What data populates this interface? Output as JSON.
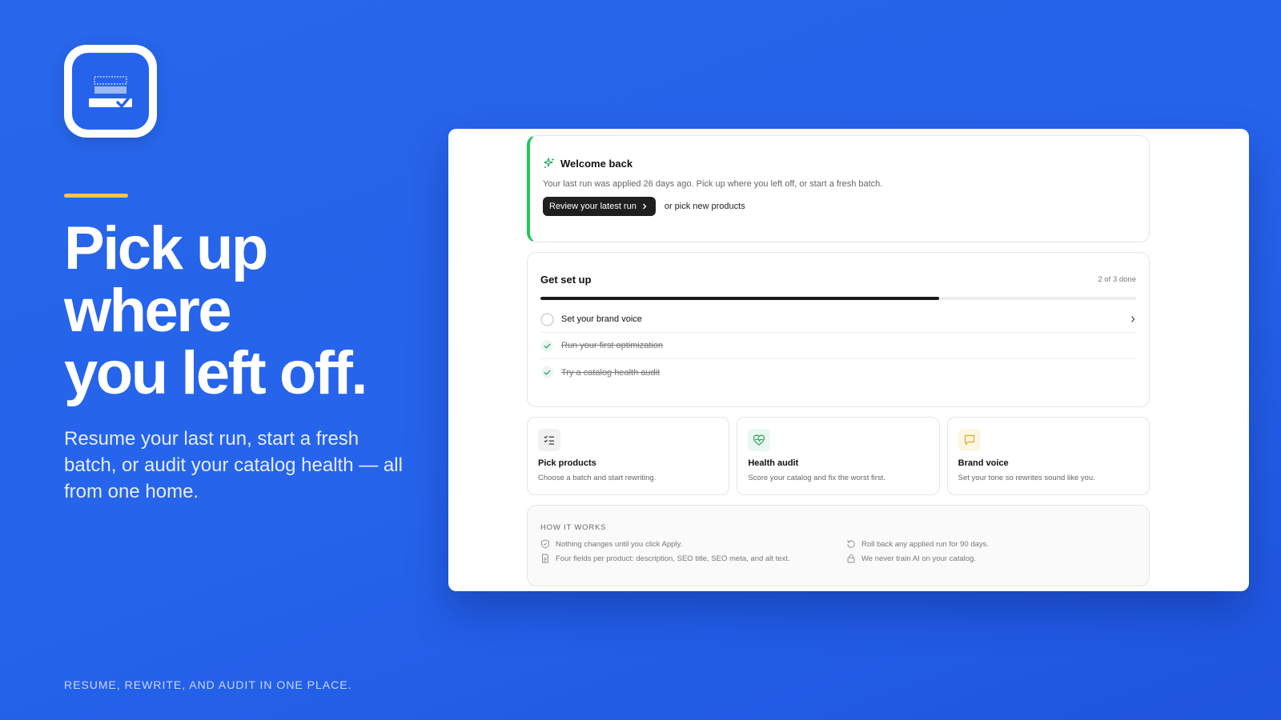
{
  "brand": {
    "accent": "#f5c542",
    "background": "#2563eb"
  },
  "hero": {
    "headline": [
      "Pick up",
      "where",
      "you left off."
    ],
    "subhead": "Resume your last run, start a fresh batch, or audit your catalog health — all from one home.",
    "footer": "RESUME, REWRITE, AND AUDIT IN ONE PLACE."
  },
  "app": {
    "welcome": {
      "icon": "sparkle-icon",
      "title": "Welcome back",
      "text": "Your last run was applied 26 days ago. Pick up where you left off, or start a fresh batch.",
      "primary_button": "Review your latest run",
      "secondary_link": "or pick new products"
    },
    "setup": {
      "title": "Get set up",
      "count": "2 of 3 done",
      "progress": 0.67,
      "tasks": [
        {
          "label": "Set your brand voice",
          "done": false
        },
        {
          "label": "Run your first optimization",
          "done": true
        },
        {
          "label": "Try a catalog health audit",
          "done": true
        }
      ]
    },
    "tiles": [
      {
        "icon": "checklist-icon",
        "title": "Pick products",
        "desc": "Choose a batch and start rewriting."
      },
      {
        "icon": "heart-pulse-icon",
        "title": "Health audit",
        "desc": "Score your catalog and fix the worst first."
      },
      {
        "icon": "chat-bubble-icon",
        "title": "Brand voice",
        "desc": "Set your tone so rewrites sound like you."
      }
    ],
    "how_it_works": {
      "title": "HOW IT WORKS",
      "items": [
        {
          "icon": "shield-check-icon",
          "text": "Nothing changes until you click Apply."
        },
        {
          "icon": "undo-icon",
          "text": "Roll back any applied run for 90 days."
        },
        {
          "icon": "document-icon",
          "text": "Four fields per product: description, SEO title, SEO meta, and alt text."
        },
        {
          "icon": "lock-icon",
          "text": "We never train AI on your catalog."
        }
      ]
    }
  }
}
